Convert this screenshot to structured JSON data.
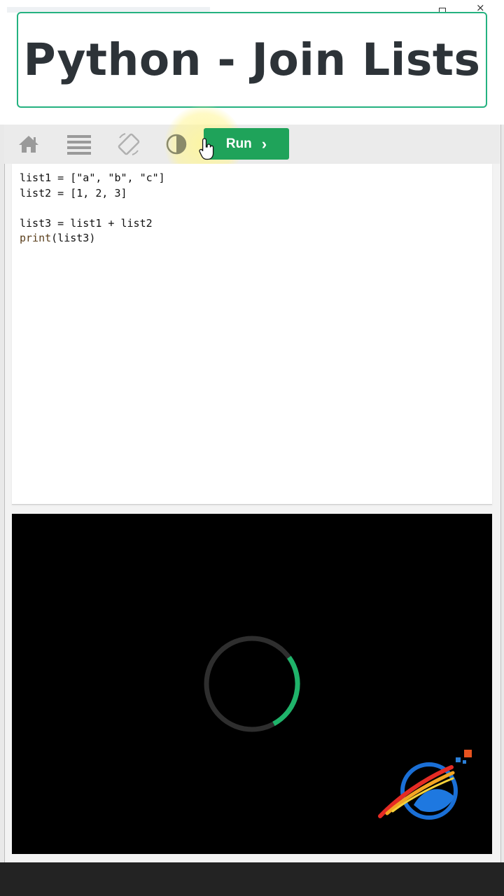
{
  "title": "Python - Join Lists",
  "toolbar": {
    "icons": [
      "home-icon",
      "menu-icon",
      "rotate-icon",
      "contrast-icon"
    ],
    "run_label": "Run",
    "run_chevron": "›"
  },
  "editor": {
    "lines": [
      "list1 = [\"a\", \"b\", \"c\"]",
      "list2 = [1, 2, 3]",
      "",
      "list3 = list1 + list2"
    ],
    "print_keyword": "print",
    "print_args": "(list3)"
  },
  "window": {
    "close_glyph": "×"
  },
  "colors": {
    "accent_green": "#1fa35a",
    "banner_border": "#24b280",
    "output_bg": "#000000",
    "spinner_progress": "#1fb36a"
  }
}
